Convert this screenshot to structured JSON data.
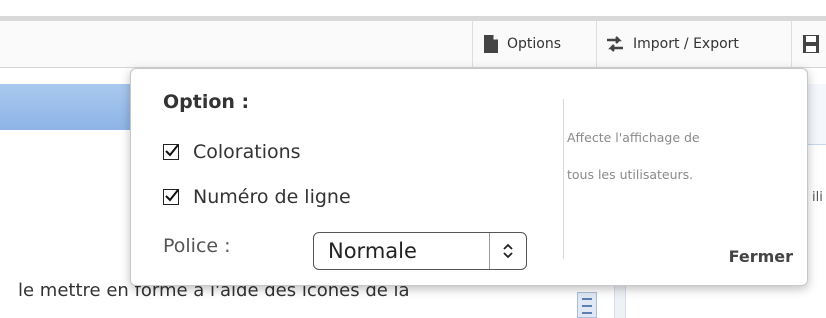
{
  "toolbar": {
    "options_label": "Options",
    "import_export_label": "Import / Export"
  },
  "popover": {
    "title": "Option :",
    "checkboxes": [
      {
        "label": "Colorations",
        "checked": true
      },
      {
        "label": "Numéro de ligne",
        "checked": true
      }
    ],
    "font_label": "Police :",
    "font_value": "Normale",
    "note_line1": "Affecte l'affichage de",
    "note_line2": "tous les utilisateurs.",
    "close_label": "Fermer"
  },
  "background": {
    "body_text": "le mettre en forme à l'aide des icônes de la",
    "right_text": "ili"
  },
  "colors": {
    "header_blue": "#8eb4e6",
    "popover_border": "#c8c8c8",
    "note_gray": "#8a8a8a"
  }
}
